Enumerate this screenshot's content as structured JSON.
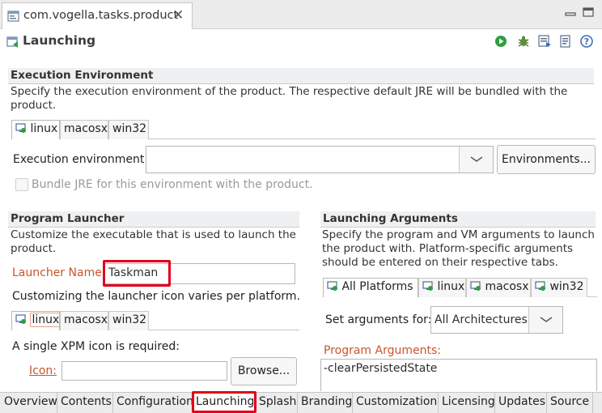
{
  "editor_tab": {
    "title": "com.vogella.tasks.product"
  },
  "page": {
    "title": "Launching"
  },
  "execution_environment": {
    "title": "Execution Environment",
    "description_line1": "Specify the execution environment of the product. The respective default JRE will be bundled with the",
    "description_line2": "product.",
    "tabs": [
      "linux",
      "macosx",
      "win32"
    ],
    "env_label": "Execution environment:",
    "env_value": "",
    "environments_button": "Environments...",
    "bundle_jre_label": "Bundle JRE for this environment with the product."
  },
  "program_launcher": {
    "title": "Program Launcher",
    "description_line1": "Customize the executable that is used to launch the",
    "description_line2": "product.",
    "launcher_name_label": "Launcher Name:",
    "launcher_name_value": "Taskman",
    "icon_note": "Customizing the launcher icon varies per platform.",
    "tabs": [
      "linux",
      "macosx",
      "win32"
    ],
    "xpm_note": "A single XPM icon is required:",
    "icon_label": "Icon:",
    "icon_value": "",
    "browse_button": "Browse..."
  },
  "launching_arguments": {
    "title": "Launching Arguments",
    "description_line1": "Specify the program and VM arguments to launch",
    "description_line2": "the product with.  Platform-specific arguments",
    "description_line3": "should be entered on their respective tabs.",
    "tabs": [
      "All Platforms",
      "linux",
      "macosx",
      "win32"
    ],
    "set_args_label": "Set arguments for:",
    "arch_value": "All Architectures",
    "program_args_label": "Program Arguments:",
    "program_args_value": "-clearPersistedState"
  },
  "bottom_tabs": [
    "Overview",
    "Contents",
    "Configuration",
    "Launching",
    "Splash",
    "Branding",
    "Customization",
    "Licensing",
    "Updates",
    "Source"
  ],
  "active_bottom_tab": "Launching",
  "colors": {
    "highlight_red": "#e0001b",
    "label_orange": "#c8552a",
    "run_green": "#2f9e3f"
  },
  "icons": [
    "product-file-icon",
    "close-icon",
    "minimize-icon",
    "maximize-icon",
    "launching-page-icon",
    "run-icon",
    "debug-icon",
    "export-icon",
    "sync-icon",
    "help-icon",
    "target-icon",
    "chevron-down-icon"
  ]
}
